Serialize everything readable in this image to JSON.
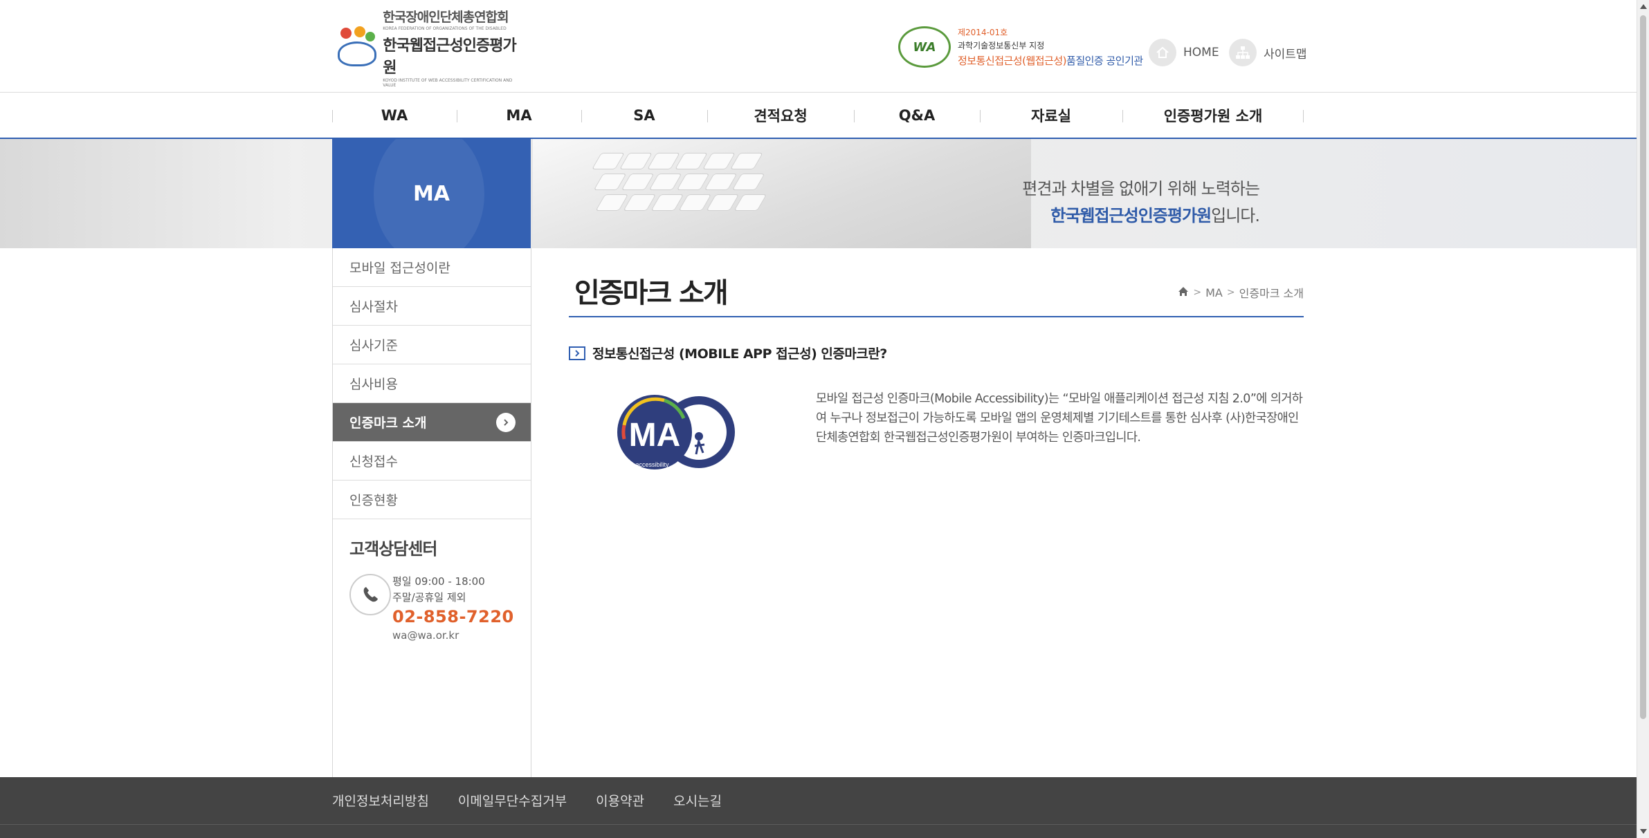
{
  "header": {
    "logo": {
      "org_name": "한국장애인단체총연합회",
      "org_name_en": "KOREA FEDERATION OF ORGANIZATIONS OF THE DISABLED",
      "institute_name": "한국웹접근성인증평가원",
      "institute_name_en": "KOYOD INSTITUTE OF WEB ACCESSIBILITY CERTIFICATION AND VALUE"
    },
    "cert": {
      "badge": "WA",
      "line1": "제2014-01호",
      "line2": "과학기술정보통신부 지정",
      "line3_a": "정보통신접근성(웹접근성)",
      "line3_b": "품질인증 공인기관"
    },
    "home_label": "HOME",
    "sitemap_label": "사이트맵"
  },
  "gnb": [
    "WA",
    "MA",
    "SA",
    "견적요청",
    "Q&A",
    "자료실",
    "인증평가원 소개"
  ],
  "visual": {
    "section_title": "MA",
    "slogan_line1": "편견과 차별을 없애기 위해 노력하는",
    "slogan_line2_highlight": "한국웹접근성인증평가원",
    "slogan_line2_rest": "입니다."
  },
  "lnb": {
    "items": [
      "모바일 접근성이란",
      "심사절차",
      "심사기준",
      "심사비용",
      "인증마크 소개",
      "신청접수",
      "인증현황"
    ],
    "active_index": 4
  },
  "customer_center": {
    "title": "고객상담센터",
    "hours_weekday": "평일 09:00 - 18:00",
    "hours_weekend": "주말/공휴일 제외",
    "phone": "02-858-7220",
    "email": "wa@wa.or.kr"
  },
  "content": {
    "page_title": "인증마크 소개",
    "breadcrumb": [
      "MA",
      "인증마크 소개"
    ],
    "subheading": "정보통신접근성 (MOBILE APP 접근성) 인증마크란?",
    "mark_text": "MA",
    "mark_caption": "Mobile accessibility",
    "description": "모바일 접근성 인증마크(Mobile Accessibility)는 “모바일 애플리케이션 접근성 지침 2.0”에 의거하여 누구나 정보접근이 가능하도록 모바일 앱의 운영체제별 기기테스트를 통한 심사후 (사)한국장애인단체총연합회 한국웹접근성인증평가원이 부여하는 인증마크입니다."
  },
  "footer": [
    "개인정보처리방침",
    "이메일무단수집거부",
    "이용약관",
    "오시는길"
  ],
  "colors": {
    "brand_blue": "#2f5eb1",
    "accent_orange": "#e0602b",
    "active_menu_bg": "#666666",
    "footer_bg": "#444444"
  }
}
